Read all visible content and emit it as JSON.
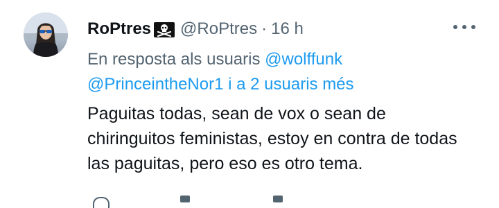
{
  "user": {
    "display_name": "RoPtres",
    "handle": "@RoPtres",
    "separator": "·",
    "time": "16 h",
    "badge_icon": "skull-crossbones-flag-icon"
  },
  "reply": {
    "prefix": "En resposta als usuaris",
    "mention_1": "@wolffunk",
    "mention_2": "@PrinceintheNor1",
    "suffix": "i a 2 usuaris més"
  },
  "tweet": {
    "text": "Paguitas todas, sean de vox o sean de chiringuitos feministas, estoy en contra de todas las paguitas, pero eso es otro tema."
  },
  "colors": {
    "text": "#0f1419",
    "secondary": "#536471",
    "link": "#1d9bf0"
  }
}
